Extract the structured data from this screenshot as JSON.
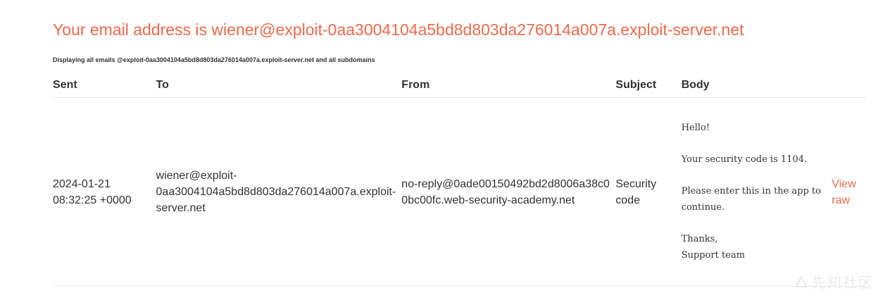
{
  "header": {
    "title": "Your email address is wiener@exploit-0aa3004104a5bd8d803da276014a007a.exploit-server.net",
    "subtitle": "Displaying all emails @exploit-0aa3004104a5bd8d803da276014a007a.exploit-server.net and all subdomains"
  },
  "table": {
    "columns": [
      "Sent",
      "To",
      "From",
      "Subject",
      "Body"
    ],
    "rows": [
      {
        "sent": "2024-01-21 08:32:25 +0000",
        "to": "wiener@exploit-0aa3004104a5bd8d803da276014a007a.exploit-server.net",
        "from": "no-reply@0ade00150492bd2d8006a38c00bc00fc.web-security-academy.net",
        "subject": "Security code",
        "body": "Hello!\n\nYour security code is 1104.\n\nPlease enter this in the app to continue.\n\nThanks,\nSupport team",
        "view_raw": "View raw"
      }
    ]
  },
  "watermark": {
    "text": "先知社区"
  },
  "colors": {
    "accent": "#ee6a4b",
    "text": "#333332",
    "divider": "#e6e6e6"
  }
}
